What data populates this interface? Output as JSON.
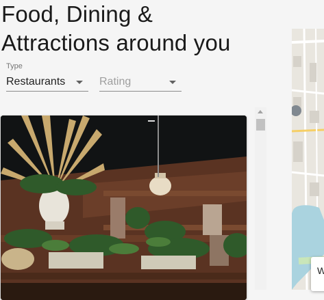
{
  "page": {
    "title_line1": "Food, Dining &",
    "title_line2": "Attractions around you"
  },
  "filters": {
    "type": {
      "label": "Type",
      "value": "Restaurants"
    },
    "rating": {
      "placeholder": "Rating"
    }
  },
  "map": {
    "popup_text": "W"
  },
  "colors": {
    "background": "#f5f5f5",
    "underline": "#8a8a8a",
    "water": "#aad3df"
  },
  "icons": [
    "dropdown-arrow-icon",
    "scroll-up-arrow-icon"
  ]
}
